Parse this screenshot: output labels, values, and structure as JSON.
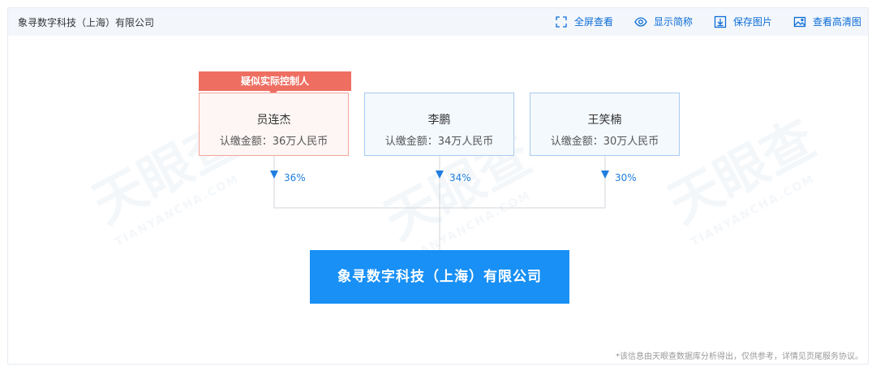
{
  "header": {
    "title": "象寻数字科技（上海）有限公司",
    "tools": [
      {
        "label": "全屏查看",
        "icon": "fullscreen-icon"
      },
      {
        "label": "显示简称",
        "icon": "eye-icon"
      },
      {
        "label": "保存图片",
        "icon": "download-icon"
      },
      {
        "label": "查看高清图",
        "icon": "image-icon"
      }
    ]
  },
  "tag": {
    "label": "疑似实际控制人"
  },
  "shareholders": [
    {
      "name": "员连杰",
      "amount": "认缴金额：36万人民币",
      "percent": "36%"
    },
    {
      "name": "李鹏",
      "amount": "认缴金额：34万人民币",
      "percent": "34%"
    },
    {
      "name": "王笑楠",
      "amount": "认缴金额：30万人民币",
      "percent": "30%"
    }
  ],
  "company": {
    "name": "象寻数字科技（上海）有限公司"
  },
  "footnote": "*该信息由天眼查数据库分析得出，仅供参考，详情见页尾服务协议。",
  "colors": {
    "accent": "#1890f5",
    "controller_tag": "#ee6f62",
    "link": "#0c6cd6"
  }
}
